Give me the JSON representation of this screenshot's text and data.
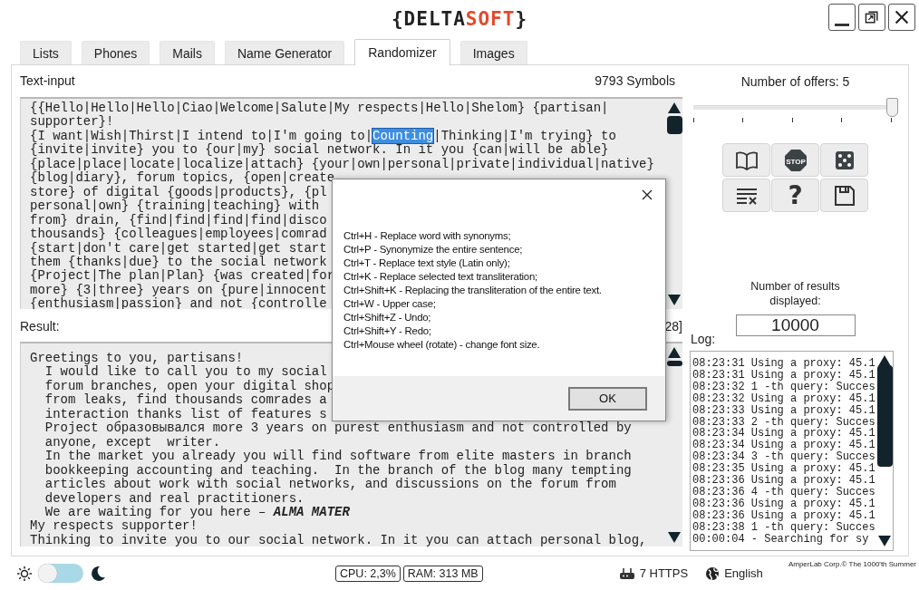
{
  "logo": {
    "open": "{",
    "main": "DELTA",
    "accent": "SOFT",
    "close": "}"
  },
  "window_controls": [
    {
      "kind": "minimize"
    },
    {
      "kind": "restore"
    },
    {
      "kind": "close"
    }
  ],
  "tabs": [
    {
      "label": "Lists",
      "selected": false
    },
    {
      "label": "Phones",
      "selected": false
    },
    {
      "label": "Mails",
      "selected": false
    },
    {
      "label": "Name Generator",
      "selected": false
    },
    {
      "label": "Randomizer",
      "selected": true
    },
    {
      "label": "Images",
      "selected": false
    }
  ],
  "text_input": {
    "label": "Text-input",
    "symbol_count": "9793 Symbols",
    "lines": [
      "{{Hello|Hello|Hello|Ciao|Welcome|Salute|My respects|Hello|Shelom} {partisan|",
      "supporter}!",
      {
        "before": "{I want|Wish|Thirst|I intend to|I'm going to|",
        "highlight": "Counting",
        "after": "|Thinking|I'm trying} to"
      },
      "{invite|invite} you to {our|my} social network. In it you {can|will be able}",
      "{place|place|locate|localize|attach} {your|own|personal|private|individual|native}",
      "{blog|diary}, forum topics, {open|create",
      "store} of digital {goods|products}, {pl",
      "personal|own} {training|teaching} with",
      "from} drain, {find|find|find|find|disco",
      "thousands} {colleagues|employees|comrad",
      "{start|don't care|get started|get start",
      "them {thanks|due} to the social network",
      "{Project|The plan|Plan} {was created|for",
      "more} {3|three} years on {pure|innocent",
      "{enthusiasm|passion} and not {controlle"
    ]
  },
  "result": {
    "label": "Result:",
    "counter": "28]",
    "lines": [
      {
        "text": "Greetings to you, partisans!",
        "indented": false
      },
      {
        "text": "I would like to call you to my social",
        "indented": true
      },
      {
        "text": "forum branches, open your digital shop",
        "indented": true
      },
      {
        "text": "from leaks, find thousands comrades a",
        "indented": true
      },
      {
        "text": "interaction thanks list of features s",
        "indented": true
      },
      {
        "text": "Project образовывался more 3 years on purest enthusiasm and not controlled by",
        "indented": true
      },
      {
        "text": "anyone, except  writer.",
        "indented": true
      },
      {
        "text": "In the market you already you will find software from elite masters in branch",
        "indented": true
      },
      {
        "text": "bookkeeping accounting and teaching.  In the branch of the blog many tempting",
        "indented": true
      },
      {
        "text": "articles about work with social networks, and discussions on the forum from",
        "indented": true
      },
      {
        "text": "developers and real practitioners.",
        "indented": true
      },
      {
        "text": "We are waiting for you here – **ALMA MATER**",
        "indented": true
      },
      {
        "text": "My respects supporter!",
        "indented": false
      },
      {
        "text": "Thinking to invite you to our social network. In it you can attach personal blog,",
        "indented": false
      }
    ]
  },
  "offers": {
    "label": "Number of offers: 5",
    "level": 1
  },
  "tool_buttons": [
    {
      "kind": "book"
    },
    {
      "kind": "stop",
      "label": "STOP"
    },
    {
      "kind": "dice"
    },
    {
      "kind": "clear"
    },
    {
      "kind": "help",
      "label": "?"
    },
    {
      "kind": "save"
    }
  ],
  "results_count": {
    "label": "Number of results displayed:",
    "value": "10000"
  },
  "log": {
    "label": "Log:",
    "lines": [
      "08:23:31 Using a proxy: 45.1",
      "08:23:31 Using a proxy: 45.1",
      "08:23:32 1 -th query: Succes",
      "08:23:32 Using a proxy: 45.1",
      "08:23:33 Using a proxy: 45.1",
      "08:23:33 2 -th query: Succes",
      "08:23:34 Using a proxy: 45.1",
      "08:23:34 Using a proxy: 45.1",
      "08:23:34 3 -th query: Succes",
      "08:23:35 Using a proxy: 45.1",
      "08:23:36 Using a proxy: 45.1",
      "08:23:36 4 -th query: Succes",
      "08:23:36 Using a proxy: 45.1",
      "08:23:36 Using a proxy: 45.1",
      "08:23:38 1 -th query: Succes",
      "00:00:04 - Searching for sy"
    ]
  },
  "status_bar": {
    "dark_mode": false,
    "cpu": "CPU: 2,3%",
    "ram": "RAM: 313 MB",
    "proxies": "7 HTTPS",
    "language": "English",
    "copyright": "AmperLab Corp.© The 1000'th Summer"
  },
  "dialog": {
    "lines": [
      "Ctrl+H - Replace word with synonyms;",
      "Ctrl+P - Synonymize the entire sentence;",
      "Ctrl+T - Replace text style (Latin only);",
      "Ctrl+K - Replace selected text transliteration;",
      "Ctrl+Shift+K - Replacing the transliteration of the entire text.",
      "Ctrl+W - Upper case;",
      "Ctrl+Shift+Z - Undo;",
      "Ctrl+Shift+Y - Redo;",
      "Ctrl+Mouse wheel (rotate) - change font size."
    ],
    "button": "OK"
  }
}
